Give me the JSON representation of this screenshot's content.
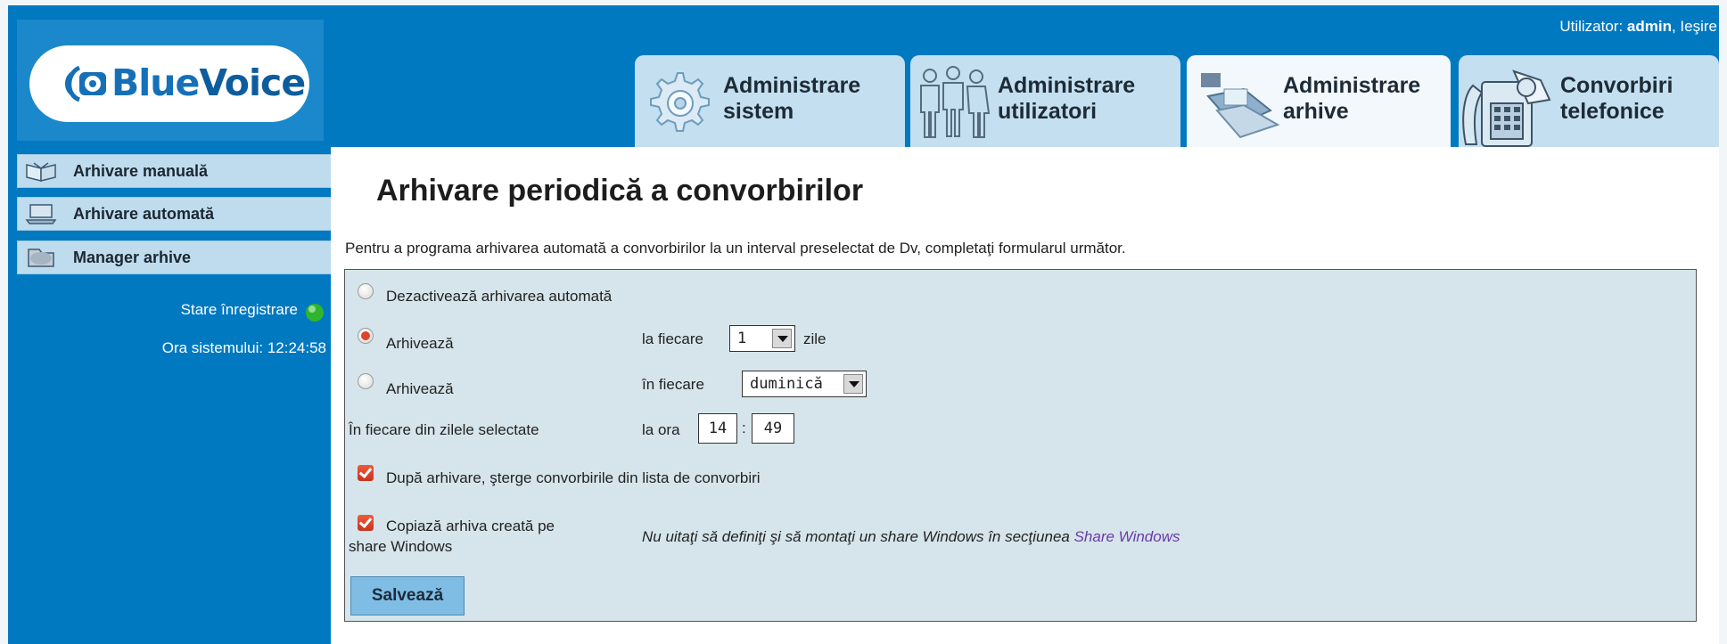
{
  "app": {
    "logo_text_a": "Blue",
    "logo_text_b": "Voice"
  },
  "userbar": {
    "prefix": "Utilizator: ",
    "username": "admin",
    "separator": ", ",
    "logout": "Ieşire"
  },
  "tabs": [
    {
      "line1": "Administrare",
      "line2": "sistem",
      "icon": "gear-icon",
      "active": false
    },
    {
      "line1": "Administrare",
      "line2": "utilizatori",
      "icon": "users-icon",
      "active": false
    },
    {
      "line1": "Administrare",
      "line2": "arhive",
      "icon": "archive-icon",
      "active": true
    },
    {
      "line1": "Convorbiri",
      "line2": "telefonice",
      "icon": "phone-icon",
      "active": false
    }
  ],
  "sidebar": {
    "items": [
      {
        "label": "Arhivare manuală",
        "icon": "book-icon"
      },
      {
        "label": "Arhivare automată",
        "icon": "laptop-icon"
      },
      {
        "label": "Manager arhive",
        "icon": "folder-icon"
      }
    ],
    "status_label": "Stare înregistrare",
    "status_color": "#2fb52f",
    "system_time_label": "Ora sistemului: ",
    "system_time": "12:24:58"
  },
  "main": {
    "title": "Arhivare periodică a convorbirilor",
    "intro": "Pentru a programa arhivarea automată a convorbirilor la un interval preselectat de Dv, completaţi formularul următor.",
    "form": {
      "opt_disable": "Dezactivează arhivarea automată",
      "opt_every_label": "Arhivează",
      "opt_every_prefix": "la fiecare",
      "opt_every_value": "1",
      "opt_every_suffix": "zile",
      "opt_weekday_label": "Arhivează",
      "opt_weekday_prefix": "în fiecare",
      "opt_weekday_value": "duminică",
      "time_row_label": "În fiecare din zilele selectate",
      "time_prefix": "la ora",
      "time_hour": "14",
      "time_sep": ":",
      "time_minute": "49",
      "delete_after_label": "După arhivare, şterge convorbirile din lista de convorbiri",
      "copy_label_line1": "Copiază arhiva creată pe",
      "copy_label_line2": "share Windows",
      "copy_note": "Nu uitaţi să definiţi şi să montaţi un share Windows în secţiunea ",
      "copy_note_link": "Share Windows",
      "selected_option": "every_n_days",
      "delete_after_checked": true,
      "copy_checked": true,
      "save_label": "Salvează"
    }
  }
}
